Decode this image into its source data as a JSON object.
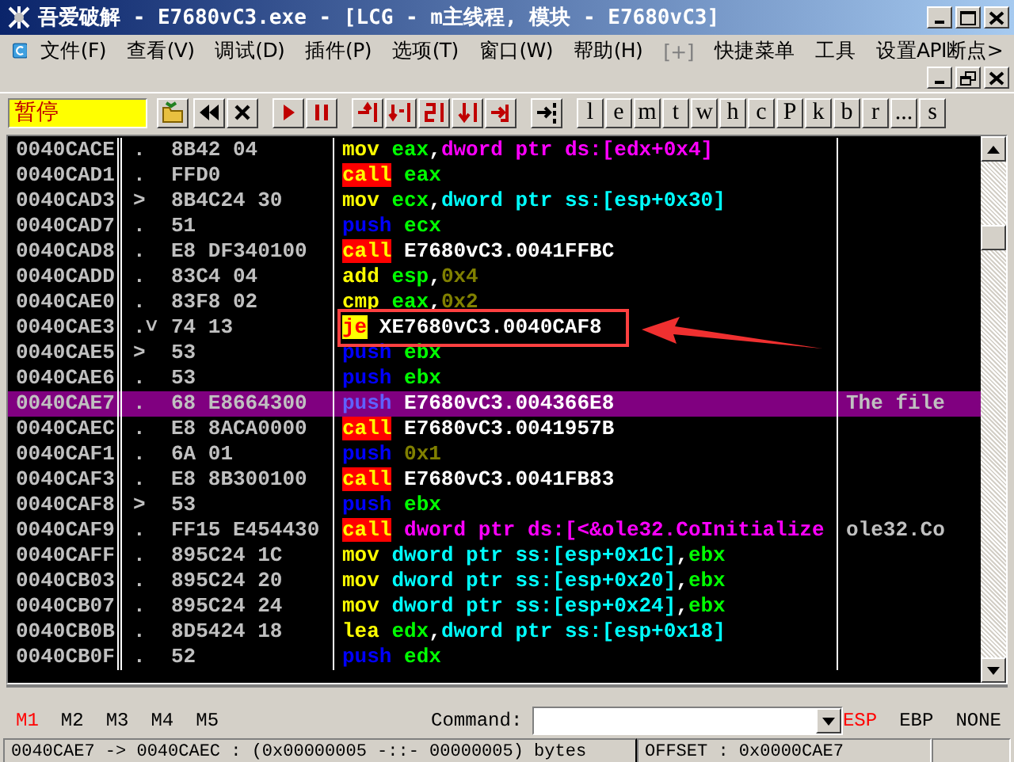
{
  "window": {
    "title": "吾爱破解 - E7680vC3.exe - [LCG - m主线程, 模块 - E7680vC3]"
  },
  "menu": [
    {
      "label": "文件(F)",
      "disabled": false
    },
    {
      "label": "查看(V)",
      "disabled": false
    },
    {
      "label": "调试(D)",
      "disabled": false
    },
    {
      "label": "插件(P)",
      "disabled": false
    },
    {
      "label": "选项(T)",
      "disabled": false
    },
    {
      "label": "窗口(W)",
      "disabled": false
    },
    {
      "label": "帮助(H)",
      "disabled": false
    },
    {
      "label": "[+]",
      "disabled": true
    },
    {
      "label": "快捷菜单",
      "disabled": false
    },
    {
      "label": "工具",
      "disabled": false
    },
    {
      "label": "设置API断点>",
      "disabled": false
    }
  ],
  "status_field": "暂停",
  "toolbar_letters": [
    "l",
    "e",
    "m",
    "t",
    "w",
    "h",
    "c",
    "P",
    "k",
    "b",
    "r",
    "...",
    "s"
  ],
  "disassembly": {
    "rows": [
      {
        "address": "0040CACE",
        "mark": ".",
        "hex": "8B42 04",
        "code": [
          {
            "text": "mov",
            "kind": "mov"
          },
          {
            "text": " eax",
            "kind": "reg"
          },
          {
            "text": ",",
            "kind": "sym"
          },
          {
            "text": "dword ptr ds:[edx+0x4]",
            "kind": "ds"
          }
        ],
        "selected": false,
        "boxed": false
      },
      {
        "address": "0040CAD1",
        "mark": ".",
        "hex": "FFD0",
        "code": [
          {
            "text": "call",
            "kind": "call"
          },
          {
            "text": " eax",
            "kind": "reg"
          }
        ],
        "selected": false,
        "boxed": false
      },
      {
        "address": "0040CAD3",
        "mark": ">",
        "hex": "8B4C24 30",
        "code": [
          {
            "text": "mov",
            "kind": "mov"
          },
          {
            "text": " ecx",
            "kind": "reg"
          },
          {
            "text": ",",
            "kind": "sym"
          },
          {
            "text": "dword ptr ss:[esp+0x30]",
            "kind": "ss"
          }
        ],
        "selected": false,
        "boxed": false
      },
      {
        "address": "0040CAD7",
        "mark": ".",
        "hex": "51",
        "code": [
          {
            "text": "push",
            "kind": "push"
          },
          {
            "text": " ecx",
            "kind": "reg"
          }
        ],
        "selected": false,
        "boxed": false
      },
      {
        "address": "0040CAD8",
        "mark": ".",
        "hex": "E8 DF340100",
        "code": [
          {
            "text": "call",
            "kind": "call"
          },
          {
            "text": " E7680vC3.0041FFBC",
            "kind": "sym"
          }
        ],
        "selected": false,
        "boxed": false
      },
      {
        "address": "0040CADD",
        "mark": ".",
        "hex": "83C4 04",
        "code": [
          {
            "text": "add",
            "kind": "mov"
          },
          {
            "text": " esp",
            "kind": "reg"
          },
          {
            "text": ",",
            "kind": "sym"
          },
          {
            "text": "0x4",
            "kind": "num"
          }
        ],
        "selected": false,
        "boxed": false
      },
      {
        "address": "0040CAE0",
        "mark": ".",
        "hex": "83F8 02",
        "code": [
          {
            "text": "cmp",
            "kind": "mov"
          },
          {
            "text": " eax",
            "kind": "reg"
          },
          {
            "text": ",",
            "kind": "sym"
          },
          {
            "text": "0x2",
            "kind": "num"
          }
        ],
        "selected": false,
        "boxed": false
      },
      {
        "address": "0040CAE3",
        "mark": ".˅",
        "hex": "74 13",
        "code": [
          {
            "text": "je",
            "kind": "jump"
          },
          {
            "text": " XE7680vC3.0040CAF8",
            "kind": "sym"
          }
        ],
        "selected": false,
        "boxed": true
      },
      {
        "address": "0040CAE5",
        "mark": ">",
        "hex": "53",
        "code": [
          {
            "text": "push",
            "kind": "push"
          },
          {
            "text": " ebx",
            "kind": "reg"
          }
        ],
        "selected": false,
        "boxed": false
      },
      {
        "address": "0040CAE6",
        "mark": ".",
        "hex": "53",
        "code": [
          {
            "text": "push",
            "kind": "push"
          },
          {
            "text": " ebx",
            "kind": "reg"
          }
        ],
        "selected": false,
        "boxed": false
      },
      {
        "address": "0040CAE7",
        "mark": ".",
        "hex": "68 E8664300",
        "code": [
          {
            "text": "push",
            "kind": "push"
          },
          {
            "text": " E7680vC3.004366E8",
            "kind": "sym"
          }
        ],
        "comment": "The file",
        "selected": true,
        "boxed": false
      },
      {
        "address": "0040CAEC",
        "mark": ".",
        "hex": "E8 8ACA0000",
        "code": [
          {
            "text": "call",
            "kind": "call"
          },
          {
            "text": " E7680vC3.0041957B",
            "kind": "sym"
          }
        ],
        "selected": false,
        "boxed": false
      },
      {
        "address": "0040CAF1",
        "mark": ".",
        "hex": "6A 01",
        "code": [
          {
            "text": "push",
            "kind": "push"
          },
          {
            "text": " 0x1",
            "kind": "num"
          }
        ],
        "selected": false,
        "boxed": false
      },
      {
        "address": "0040CAF3",
        "mark": ".",
        "hex": "E8 8B300100",
        "code": [
          {
            "text": "call",
            "kind": "call"
          },
          {
            "text": " E7680vC3.0041FB83",
            "kind": "sym"
          }
        ],
        "selected": false,
        "boxed": false
      },
      {
        "address": "0040CAF8",
        "mark": ">",
        "hex": "53",
        "code": [
          {
            "text": "push",
            "kind": "push"
          },
          {
            "text": " ebx",
            "kind": "reg"
          }
        ],
        "selected": false,
        "boxed": false
      },
      {
        "address": "0040CAF9",
        "mark": ".",
        "hex": "FF15 E454430",
        "code": [
          {
            "text": "call",
            "kind": "call"
          },
          {
            "text": " dword ptr ds:[<&ole32.CoInitialize",
            "kind": "ds"
          }
        ],
        "comment": "ole32.Co",
        "selected": false,
        "boxed": false
      },
      {
        "address": "0040CAFF",
        "mark": ".",
        "hex": "895C24 1C",
        "code": [
          {
            "text": "mov",
            "kind": "mov"
          },
          {
            "text": " dword ptr ss:[esp+0x1C]",
            "kind": "ss"
          },
          {
            "text": ",",
            "kind": "sym"
          },
          {
            "text": "ebx",
            "kind": "reg"
          }
        ],
        "selected": false,
        "boxed": false
      },
      {
        "address": "0040CB03",
        "mark": ".",
        "hex": "895C24 20",
        "code": [
          {
            "text": "mov",
            "kind": "mov"
          },
          {
            "text": " dword ptr ss:[esp+0x20]",
            "kind": "ss"
          },
          {
            "text": ",",
            "kind": "sym"
          },
          {
            "text": "ebx",
            "kind": "reg"
          }
        ],
        "selected": false,
        "boxed": false
      },
      {
        "address": "0040CB07",
        "mark": ".",
        "hex": "895C24 24",
        "code": [
          {
            "text": "mov",
            "kind": "mov"
          },
          {
            "text": " dword ptr ss:[esp+0x24]",
            "kind": "ss"
          },
          {
            "text": ",",
            "kind": "sym"
          },
          {
            "text": "ebx",
            "kind": "reg"
          }
        ],
        "selected": false,
        "boxed": false
      },
      {
        "address": "0040CB0B",
        "mark": ".",
        "hex": "8D5424 18",
        "code": [
          {
            "text": "lea",
            "kind": "mov"
          },
          {
            "text": " edx",
            "kind": "reg"
          },
          {
            "text": ",",
            "kind": "sym"
          },
          {
            "text": "dword ptr ss:[esp+0x18]",
            "kind": "ss"
          }
        ],
        "selected": false,
        "boxed": false
      },
      {
        "address": "0040CB0F",
        "mark": ".",
        "hex": "52",
        "code": [
          {
            "text": "push",
            "kind": "push"
          },
          {
            "text": " edx",
            "kind": "reg"
          }
        ],
        "selected": false,
        "boxed": false
      }
    ]
  },
  "memory_tabs": [
    {
      "label": "M1",
      "selected": true
    },
    {
      "label": "M2",
      "selected": false
    },
    {
      "label": "M3",
      "selected": false
    },
    {
      "label": "M4",
      "selected": false
    },
    {
      "label": "M5",
      "selected": false
    }
  ],
  "command": {
    "label": "Command:"
  },
  "stack_buttons": [
    {
      "label": "ESP",
      "selected": true
    },
    {
      "label": "EBP",
      "selected": false
    },
    {
      "label": "NONE",
      "selected": false
    }
  ],
  "status_bar": {
    "info": "0040CAE7 -> 0040CAEC : (0x00000005 -::- 00000005) bytes",
    "offset": "OFFSET : 0x0000CAE7"
  }
}
